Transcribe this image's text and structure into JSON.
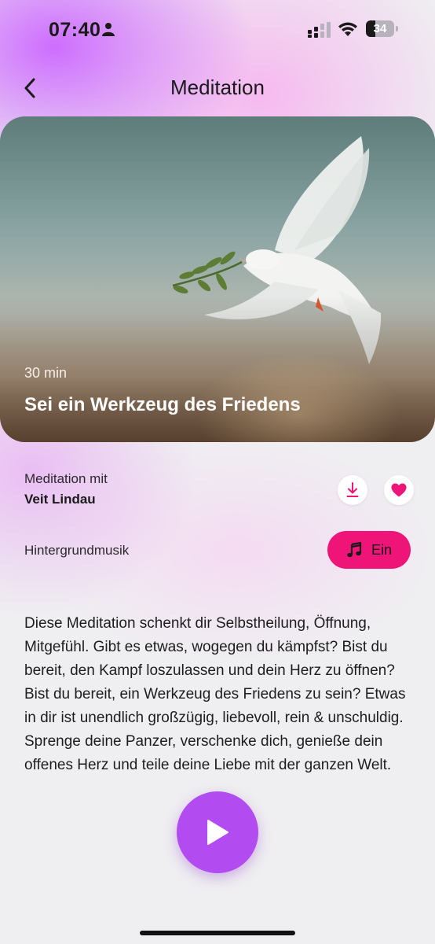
{
  "status_bar": {
    "time": "07:40",
    "battery": "34",
    "icons": [
      "person-icon",
      "signal-icon",
      "wifi-icon",
      "battery-icon"
    ]
  },
  "header": {
    "title": "Meditation",
    "back_icon": "chevron-left-icon"
  },
  "hero": {
    "duration": "30 min",
    "title": "Sei ein Werkzeug des Friedens",
    "image": "dove-with-olive-branch"
  },
  "teacher": {
    "label": "Meditation mit",
    "name": "Veit Lindau"
  },
  "actions": {
    "download_icon": "download-icon",
    "favorite_icon": "heart-icon"
  },
  "music": {
    "label": "Hintergrundmusik",
    "toggle_label": "Ein",
    "icon": "music-note-icon"
  },
  "description": "Diese Meditation schenkt dir Selbstheilung, Öffnung, Mitgefühl. Gibt es etwas, wogegen du kämpfst? Bist du bereit, den Kampf loszulassen und dein Herz zu öffnen? Bist du bereit, ein Werkzeug des Friedens zu sein? Etwas in dir ist unendlich großzügig, liebevoll, rein & unschuldig. Sprenge deine Panzer, verschenke dich, genieße dein offenes Herz und teile deine Liebe mit der ganzen Welt.",
  "player": {
    "play_icon": "play-icon"
  },
  "colors": {
    "accent_pink": "#ee1478",
    "accent_purple": "#b24bf0",
    "background": "#efeef1"
  }
}
